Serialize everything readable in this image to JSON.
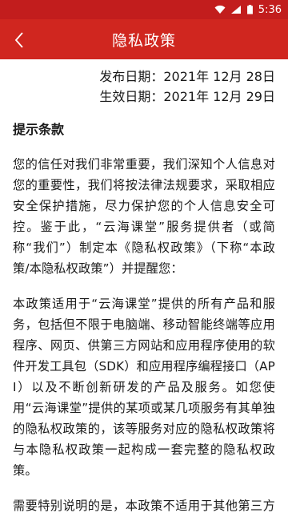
{
  "status_bar": {
    "time": "5:36"
  },
  "app_bar": {
    "title": "隐私政策"
  },
  "dates": {
    "published": "发布日期：2021年 12月 28日",
    "effective": "生效日期：2021年 12月 29日"
  },
  "section_title": "提示条款",
  "paragraphs": [
    "您的信任对我们非常重要，我们深知个人信息对您的重要性，我们将按法律法规要求，采取相应安全保护措施，尽力保护您的个人信息安全可控。鉴于此，“云海课堂”服务提供者（或简称“我们”）制定本《隐私权政策》（下称“本政策/本隐私权政策”）并提醒您：",
    "本政策适用于“云海课堂”提供的所有产品和服务，包括但不限于电脑端、移动智能终端等应用程序、网页、供第三方网站和应用程序使用的软件开发工具包（SDK）和应用程序编程接口（API）以及不断创新研发的产品及服务。如您使用“云海课堂”提供的某项或某几项服务有其单独的隐私权政策的，该等服务对应的隐私权政策将与本隐私权政策一起构成一套完整的隐私权政策。",
    "需要特别说明的是，本政策不适用于其他第三方向您提供的服务，为确保流畅的产品体验，"
  ],
  "colors": {
    "app_bar": "#d0261f",
    "status_bar": "#c21d1d"
  },
  "icons": {
    "back": "chevron-left-icon",
    "wifi": "wifi-icon",
    "signal": "signal-icon",
    "battery": "battery-icon"
  }
}
